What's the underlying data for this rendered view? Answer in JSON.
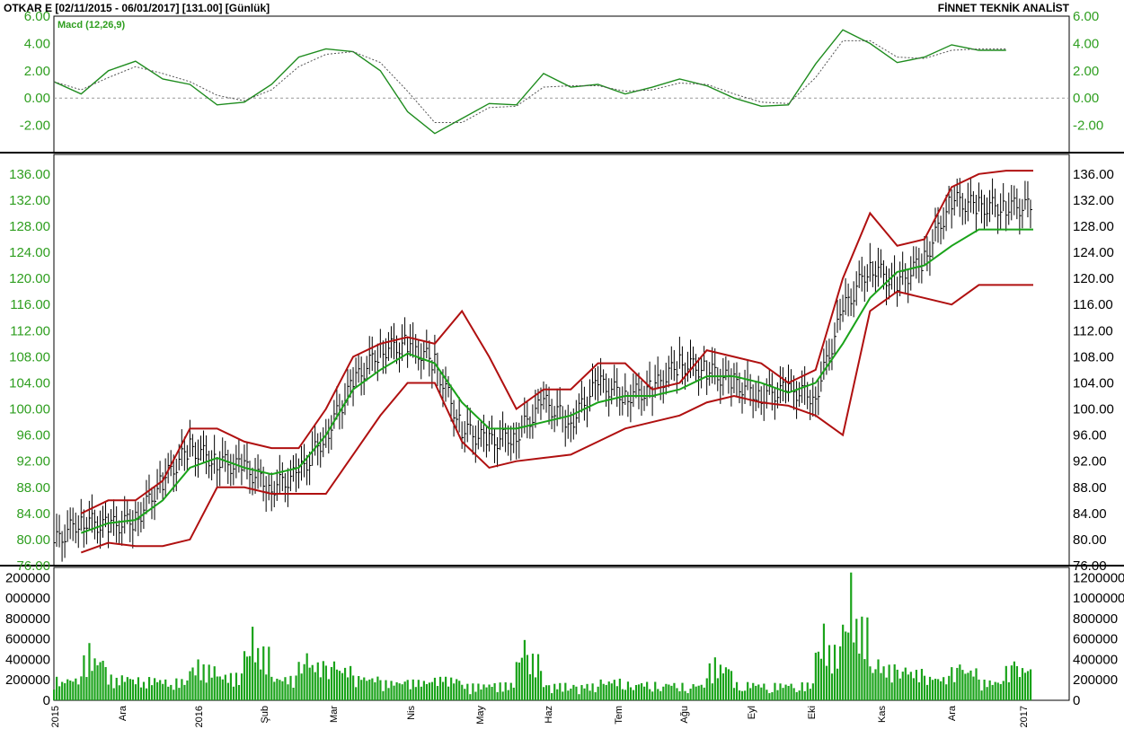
{
  "header": {
    "symbol_range": "OTKAR E  [02/11/2015 - 06/01/2017]  [131.00]  [Günlük]",
    "provider": "FİNNET TEKNİK ANALİST"
  },
  "colors": {
    "price_axis": "#2e9e1f",
    "macd_line": "#1e8c1e",
    "signal_line": "#555555",
    "bollinger_band": "#b01010",
    "bollinger_mid": "#1aa31a",
    "volume_bar": "#1aa31a",
    "candle": "#000000"
  },
  "chart_data": [
    {
      "type": "line",
      "panel": "macd",
      "indicator_label": "Macd (12,26,9)",
      "ylim": [
        -4,
        6
      ],
      "yticks": [
        "6.00",
        "4.00",
        "2.00",
        "0.00",
        "-2.00"
      ],
      "zero_line": true,
      "x": [
        0.09,
        0.12,
        0.15,
        0.18,
        0.21,
        0.24,
        0.27,
        0.3,
        0.33,
        0.36,
        0.39,
        0.42,
        0.45,
        0.48,
        0.51,
        0.54,
        0.57,
        0.6,
        0.63,
        0.66,
        0.69,
        0.72,
        0.75,
        0.78,
        0.81,
        0.84,
        0.87,
        0.9,
        0.93,
        0.96,
        0.99,
        1.02,
        1.05,
        1.08,
        1.11,
        1.14
      ],
      "series": [
        {
          "name": "Macd",
          "values": [
            1.2,
            0.3,
            2.0,
            2.7,
            1.4,
            1.0,
            -0.5,
            -0.3,
            1.0,
            3.0,
            3.6,
            3.4,
            2.0,
            -1.0,
            -2.6,
            -1.5,
            -0.4,
            -0.5,
            1.8,
            0.8,
            1.0,
            0.3,
            0.8,
            1.4,
            0.9,
            0.0,
            -0.6,
            -0.5,
            2.5,
            5.0,
            4.0,
            2.6,
            3.0,
            3.9,
            3.5,
            3.5
          ]
        },
        {
          "name": "Signal",
          "values": [
            1.2,
            0.6,
            1.5,
            2.3,
            1.8,
            1.2,
            0.2,
            -0.2,
            0.6,
            2.3,
            3.2,
            3.4,
            2.6,
            0.5,
            -1.8,
            -1.8,
            -0.7,
            -0.6,
            0.8,
            0.9,
            0.9,
            0.5,
            0.6,
            1.1,
            1.0,
            0.3,
            -0.3,
            -0.4,
            1.5,
            4.2,
            4.2,
            3.0,
            2.9,
            3.5,
            3.6,
            3.6
          ]
        }
      ]
    },
    {
      "type": "candlestick",
      "panel": "price",
      "ylim": [
        76,
        139
      ],
      "yticks": [
        "136.00",
        "132.00",
        "128.00",
        "124.00",
        "120.00",
        "116.00",
        "112.00",
        "108.00",
        "104.00",
        "100.00",
        "96.00",
        "92.00",
        "88.00",
        "84.00",
        "80.00",
        "76.00"
      ],
      "x": [
        0.06,
        0.09,
        0.12,
        0.15,
        0.18,
        0.21,
        0.24,
        0.27,
        0.3,
        0.33,
        0.36,
        0.39,
        0.42,
        0.45,
        0.48,
        0.51,
        0.54,
        0.57,
        0.6,
        0.63,
        0.66,
        0.69,
        0.72,
        0.75,
        0.78,
        0.81,
        0.84,
        0.87,
        0.9,
        0.93,
        0.96,
        0.99,
        1.02,
        1.05,
        1.08,
        1.11,
        1.14
      ],
      "close": [
        79.5,
        83,
        82,
        83,
        89,
        94,
        92,
        91,
        88,
        90,
        96,
        104,
        109,
        110,
        107,
        97,
        95,
        96,
        101,
        98,
        104,
        102,
        103,
        107,
        106,
        104,
        102,
        103,
        102,
        115,
        122,
        119,
        123,
        132,
        131,
        131,
        131
      ],
      "series": [
        {
          "name": "Bollinger Upper",
          "values": [
            null,
            84,
            86,
            86,
            89,
            97,
            97,
            95,
            94,
            94,
            100,
            108,
            110,
            111,
            110,
            115,
            108,
            100,
            103,
            103,
            107,
            107,
            103,
            104,
            109,
            108,
            107,
            104,
            106,
            120,
            130,
            125,
            126,
            134,
            136,
            136.5,
            136.5
          ]
        },
        {
          "name": "Bollinger Middle",
          "values": [
            null,
            81,
            82.5,
            83,
            86,
            91,
            92.5,
            91,
            90,
            91,
            96,
            103,
            106,
            108.5,
            107,
            101,
            97,
            97,
            98,
            99,
            101,
            102,
            102,
            103,
            105,
            105,
            104,
            102.5,
            104,
            110,
            117,
            121,
            122,
            125,
            127.5,
            127.5,
            127.5
          ]
        },
        {
          "name": "Bollinger Lower",
          "values": [
            null,
            78,
            79.5,
            79,
            79,
            80,
            88,
            88,
            87,
            87,
            87,
            93,
            99,
            104,
            104,
            95,
            91,
            92,
            92.5,
            93,
            95,
            97,
            98,
            99,
            101,
            102,
            101,
            100.5,
            99,
            96,
            115,
            118,
            117,
            116,
            119,
            119,
            119
          ]
        }
      ]
    },
    {
      "type": "bar",
      "panel": "volume",
      "ylim": [
        0,
        1300000
      ],
      "yticks_left": [
        "200000",
        "000000",
        "800000",
        "600000",
        "400000",
        "200000",
        "0"
      ],
      "yticks_right": [
        "1200000",
        "1000000",
        "800000",
        "600000",
        "400000",
        "200000",
        "0"
      ],
      "x": [
        0.06,
        0.09,
        0.12,
        0.15,
        0.18,
        0.21,
        0.24,
        0.27,
        0.3,
        0.33,
        0.36,
        0.39,
        0.42,
        0.45,
        0.48,
        0.51,
        0.54,
        0.57,
        0.6,
        0.63,
        0.66,
        0.69,
        0.72,
        0.75,
        0.78,
        0.81,
        0.84,
        0.87,
        0.9,
        0.93,
        0.96,
        0.99,
        1.02,
        1.05,
        1.08,
        1.11,
        1.14
      ],
      "values": [
        180000,
        560000,
        220000,
        180000,
        150000,
        400000,
        250000,
        720000,
        200000,
        460000,
        380000,
        200000,
        120000,
        130000,
        180000,
        60000,
        80000,
        590000,
        70000,
        60000,
        150000,
        100000,
        90000,
        70000,
        420000,
        90000,
        70000,
        80000,
        750000,
        1250000,
        400000,
        320000,
        200000,
        350000,
        130000,
        380000,
        100000
      ]
    }
  ],
  "x_axis": {
    "labels": [
      "2015",
      "Ara",
      "2016",
      "Şub",
      "Mar",
      "Nis",
      "May",
      "Haz",
      "Tem",
      "Ağu",
      "Eyl",
      "Eki",
      "Kas",
      "Ara",
      "2017"
    ],
    "positions": [
      62,
      137,
      222,
      295,
      372,
      458,
      535,
      611,
      689,
      762,
      837,
      904,
      982,
      1060,
      1140
    ]
  }
}
